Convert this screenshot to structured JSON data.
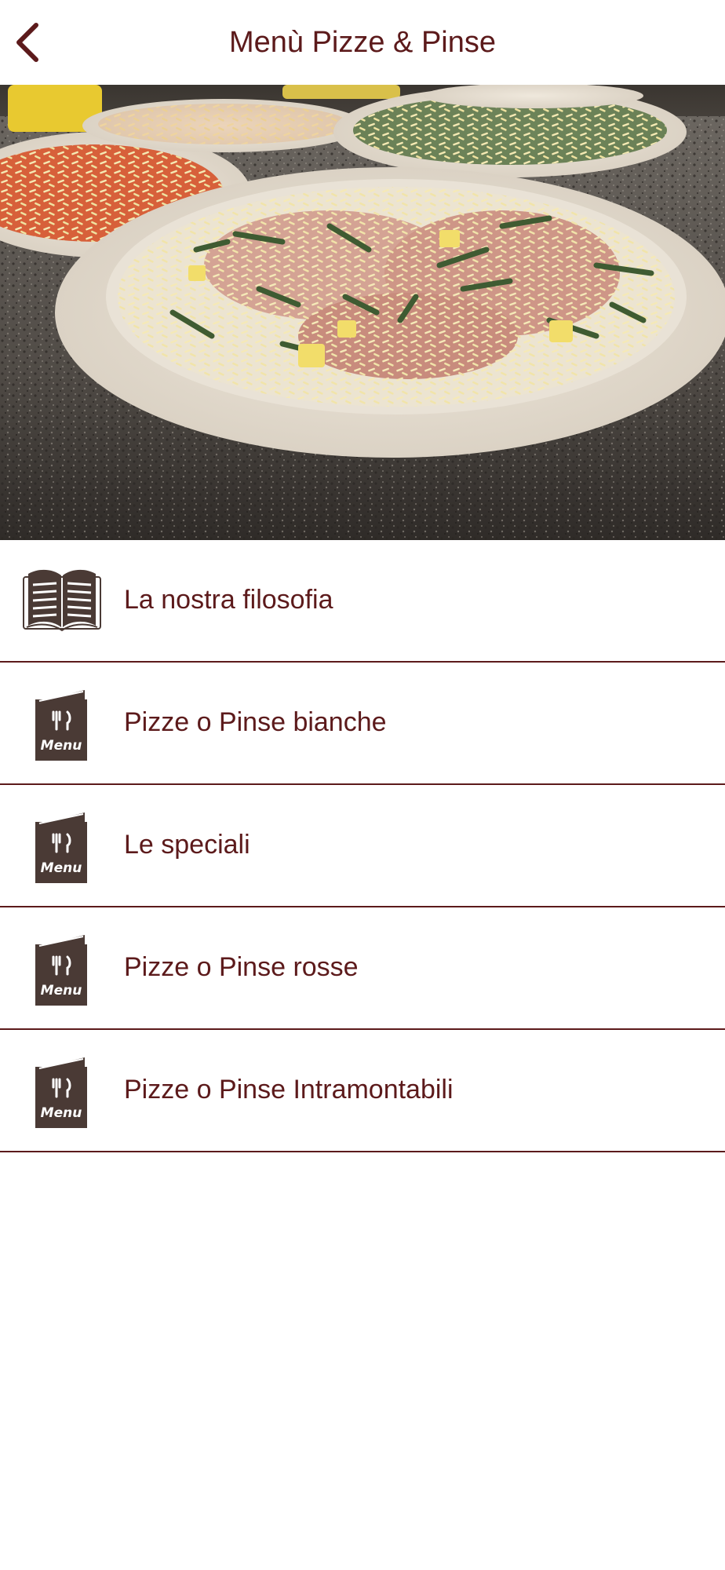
{
  "header": {
    "title": "Menù Pizze & Pinse",
    "back_icon": "chevron-left-icon"
  },
  "colors": {
    "accent": "#5c1a1b",
    "icon_dark": "#4a3a35",
    "background": "#ffffff"
  },
  "hero": {
    "image": "pizza-photo"
  },
  "menu": {
    "items": [
      {
        "label": "La nostra filosofia",
        "icon": "open-book-icon"
      },
      {
        "label": "Pizze o Pinse bianche",
        "icon": "menu-card-icon"
      },
      {
        "label": "Le speciali",
        "icon": "menu-card-icon"
      },
      {
        "label": "Pizze o Pinse rosse",
        "icon": "menu-card-icon"
      },
      {
        "label": "Pizze o Pinse Intramontabili",
        "icon": "menu-card-icon"
      }
    ],
    "menu_card_text": "Menu"
  }
}
